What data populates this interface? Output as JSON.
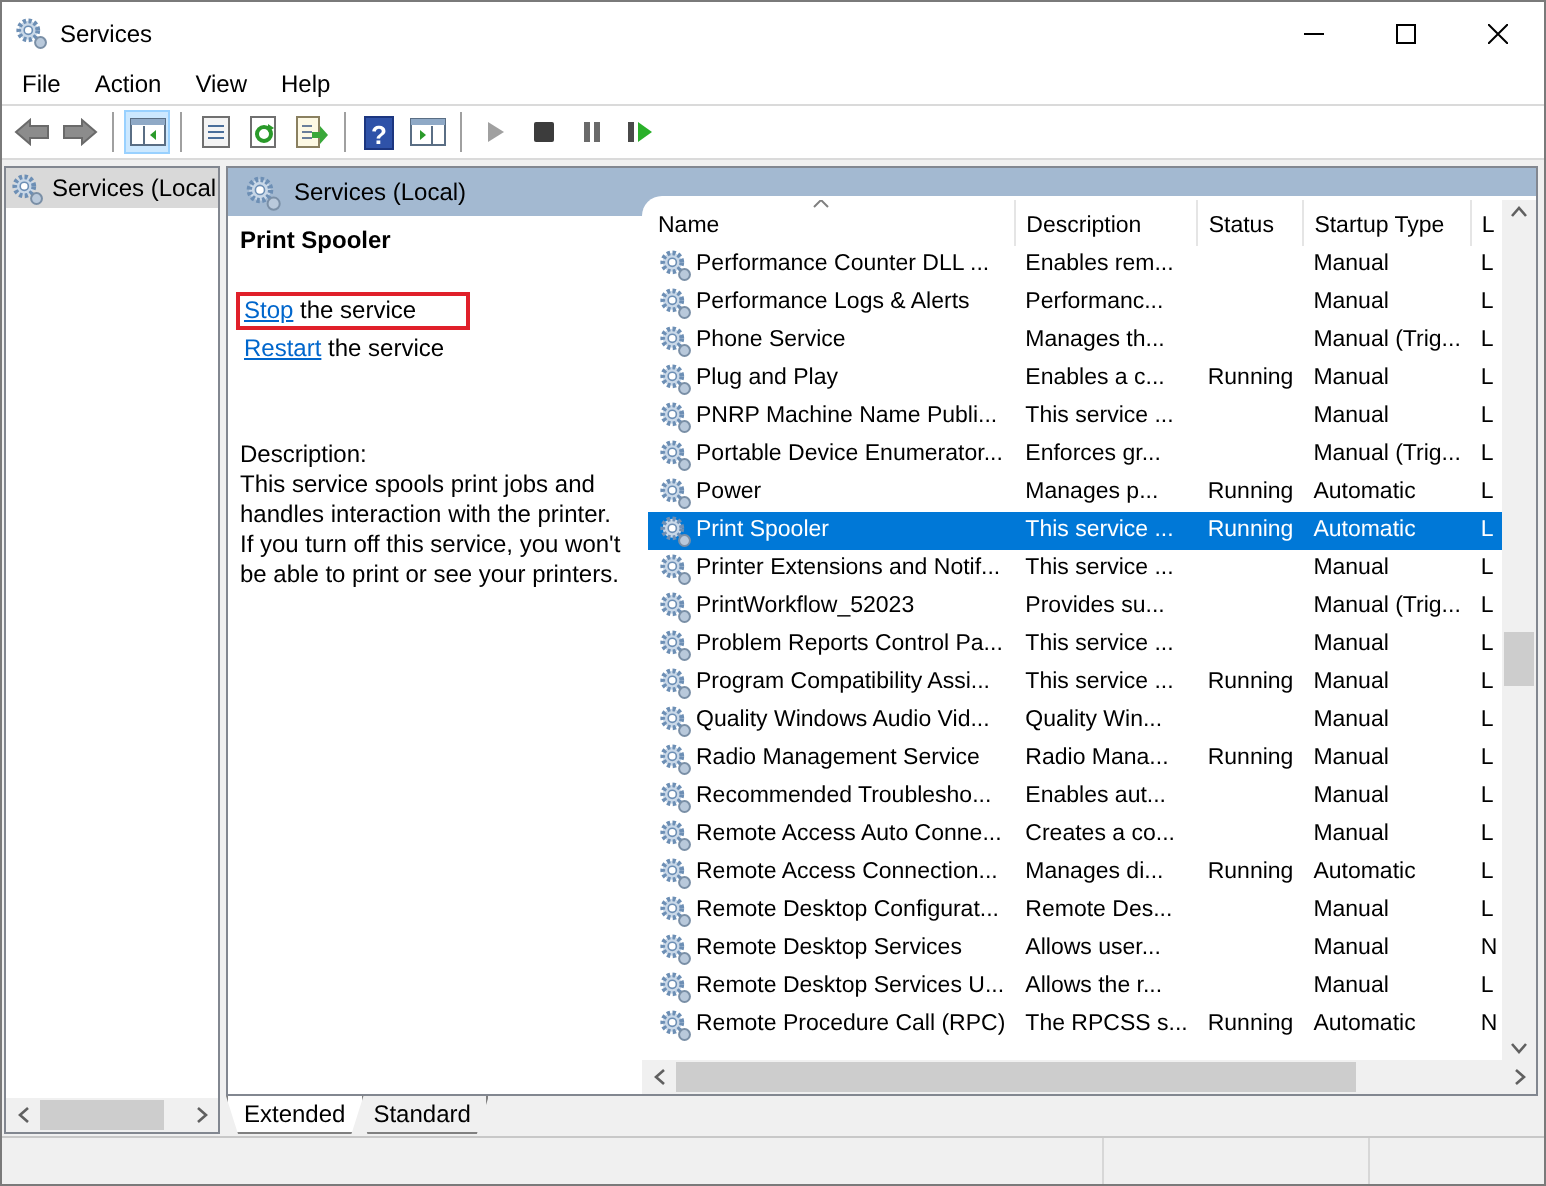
{
  "window": {
    "title": "Services"
  },
  "menu": [
    "File",
    "Action",
    "View",
    "Help"
  ],
  "toolbar": [
    {
      "kind": "back",
      "disabled": false,
      "pressed": false
    },
    {
      "kind": "forward",
      "disabled": false,
      "pressed": false
    },
    {
      "kind": "separator"
    },
    {
      "kind": "console-tree",
      "disabled": false,
      "pressed": true
    },
    {
      "kind": "separator"
    },
    {
      "kind": "properties",
      "disabled": false,
      "pressed": false
    },
    {
      "kind": "refresh",
      "disabled": false,
      "pressed": false
    },
    {
      "kind": "export",
      "disabled": false,
      "pressed": false
    },
    {
      "kind": "separator"
    },
    {
      "kind": "help",
      "glyph": "?",
      "disabled": false,
      "pressed": false
    },
    {
      "kind": "action-pane",
      "disabled": false,
      "pressed": false
    },
    {
      "kind": "separator"
    },
    {
      "kind": "play",
      "disabled": true,
      "pressed": false
    },
    {
      "kind": "stop",
      "disabled": false,
      "pressed": false
    },
    {
      "kind": "pause",
      "disabled": false,
      "pressed": false
    },
    {
      "kind": "resume",
      "disabled": false,
      "pressed": false
    }
  ],
  "tree": {
    "items": [
      {
        "label": "Services (Local",
        "selected": true
      }
    ]
  },
  "panel": {
    "title": "Services (Local)"
  },
  "details": {
    "title": "Print Spooler",
    "actions": [
      {
        "link": "Stop",
        "text": "the service",
        "highlighted": true
      },
      {
        "link": "Restart",
        "text": "the service",
        "highlighted": false
      }
    ],
    "description_label": "Description:",
    "description": "This service spools print jobs and handles interaction with the printer. If you turn off this service, you won't be able to print or see your printers."
  },
  "table": {
    "columns": [
      {
        "label": "Name",
        "sorted": true
      },
      {
        "label": "Description",
        "sorted": false
      },
      {
        "label": "Status",
        "sorted": false
      },
      {
        "label": "Startup Type",
        "sorted": false
      },
      {
        "label": "L",
        "sorted": false
      }
    ],
    "rows": [
      {
        "name": "Performance Counter DLL ...",
        "description": "Enables rem...",
        "status": "",
        "startup_type": "Manual",
        "column_5": "L",
        "selected": false
      },
      {
        "name": "Performance Logs & Alerts",
        "description": "Performanc...",
        "status": "",
        "startup_type": "Manual",
        "column_5": "L",
        "selected": false
      },
      {
        "name": "Phone Service",
        "description": "Manages th...",
        "status": "",
        "startup_type": "Manual (Trig...",
        "column_5": "L",
        "selected": false
      },
      {
        "name": "Plug and Play",
        "description": "Enables a c...",
        "status": "Running",
        "startup_type": "Manual",
        "column_5": "L",
        "selected": false
      },
      {
        "name": "PNRP Machine Name Publi...",
        "description": "This service ...",
        "status": "",
        "startup_type": "Manual",
        "column_5": "L",
        "selected": false
      },
      {
        "name": "Portable Device Enumerator...",
        "description": "Enforces gr...",
        "status": "",
        "startup_type": "Manual (Trig...",
        "column_5": "L",
        "selected": false
      },
      {
        "name": "Power",
        "description": "Manages p...",
        "status": "Running",
        "startup_type": "Automatic",
        "column_5": "L",
        "selected": false
      },
      {
        "name": "Print Spooler",
        "description": "This service ...",
        "status": "Running",
        "startup_type": "Automatic",
        "column_5": "L",
        "selected": true
      },
      {
        "name": "Printer Extensions and Notif...",
        "description": "This service ...",
        "status": "",
        "startup_type": "Manual",
        "column_5": "L",
        "selected": false
      },
      {
        "name": "PrintWorkflow_52023",
        "description": "Provides su...",
        "status": "",
        "startup_type": "Manual (Trig...",
        "column_5": "L",
        "selected": false
      },
      {
        "name": "Problem Reports Control Pa...",
        "description": "This service ...",
        "status": "",
        "startup_type": "Manual",
        "column_5": "L",
        "selected": false
      },
      {
        "name": "Program Compatibility Assi...",
        "description": "This service ...",
        "status": "Running",
        "startup_type": "Manual",
        "column_5": "L",
        "selected": false
      },
      {
        "name": "Quality Windows Audio Vid...",
        "description": "Quality Win...",
        "status": "",
        "startup_type": "Manual",
        "column_5": "L",
        "selected": false
      },
      {
        "name": "Radio Management Service",
        "description": "Radio Mana...",
        "status": "Running",
        "startup_type": "Manual",
        "column_5": "L",
        "selected": false
      },
      {
        "name": "Recommended Troublesho...",
        "description": "Enables aut...",
        "status": "",
        "startup_type": "Manual",
        "column_5": "L",
        "selected": false
      },
      {
        "name": "Remote Access Auto Conne...",
        "description": "Creates a co...",
        "status": "",
        "startup_type": "Manual",
        "column_5": "L",
        "selected": false
      },
      {
        "name": "Remote Access Connection...",
        "description": "Manages di...",
        "status": "Running",
        "startup_type": "Automatic",
        "column_5": "L",
        "selected": false
      },
      {
        "name": "Remote Desktop Configurat...",
        "description": "Remote Des...",
        "status": "",
        "startup_type": "Manual",
        "column_5": "L",
        "selected": false
      },
      {
        "name": "Remote Desktop Services",
        "description": "Allows user...",
        "status": "",
        "startup_type": "Manual",
        "column_5": "N",
        "selected": false
      },
      {
        "name": "Remote Desktop Services U...",
        "description": "Allows the r...",
        "status": "",
        "startup_type": "Manual",
        "column_5": "L",
        "selected": false
      },
      {
        "name": "Remote Procedure Call (RPC)",
        "description": "The RPCSS s...",
        "status": "Running",
        "startup_type": "Automatic",
        "column_5": "N",
        "selected": false
      }
    ]
  },
  "view_tabs": [
    {
      "label": "Extended",
      "selected": true
    },
    {
      "label": "Standard",
      "selected": false
    }
  ]
}
